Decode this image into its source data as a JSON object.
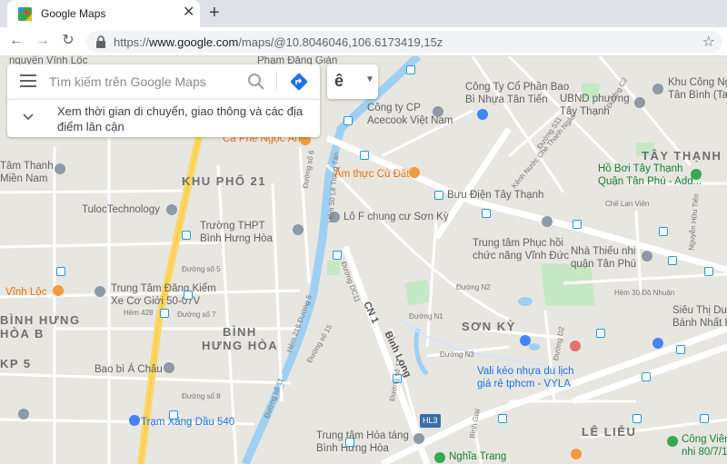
{
  "browser": {
    "tab_title": "Google Maps",
    "tab_close": "✕",
    "new_tab": "+",
    "url_prefix": "https://",
    "url_host": "www.google.com",
    "url_path": "/maps/@10.8046046,106.6173419,15z",
    "back": "←",
    "forward": "→",
    "reload": "↻",
    "star": "☆"
  },
  "search": {
    "placeholder": "Tìm kiếm trên Google Maps",
    "nearby_text": "Xem thời gian di chuyển, giao thông và các địa điểm lân cận",
    "lang_label": "ê",
    "lang_caret": "▼"
  },
  "map": {
    "colors": {
      "road": "#ffffff",
      "highway": "#fdd663",
      "water": "#9fd0f3",
      "park": "#c5e8c5",
      "background": "#e8e6e1",
      "transit_line": "#1a9cd9"
    },
    "areas": {
      "khu_pho_21": "KHU PHỐ 21",
      "tay_thanh": "TÂY THẠNH",
      "binh_hung_hoa_1": "BÌNH",
      "binh_hung_hoa_2": "HƯNG HÒA",
      "son_ky": "SƠN KỲ",
      "le_lieu": "LÊ LIỄU",
      "binh_hung_left_1": "BÌNH HƯNG",
      "binh_hung_left_2": "HÒA B",
      "kp5": "KP 5"
    },
    "pois": {
      "pham_dang": "Phạm Đăng Giản",
      "vinh_loc_top": "nguyện Vĩnh Lộc",
      "cong_ty_cp_bao_bi_1": "Công Ty Cổ Phần Bao",
      "cong_ty_cp_bao_bi_2": "Bì Nhựa Tân Tiến",
      "khu_cong_nghiep_1": "Khu Công Nghiệp",
      "khu_cong_nghiep_2": "Tân Bình (Tanime",
      "acecook_1": "Công ty CP",
      "acecook_2": "Acecook Việt Nam",
      "ubnd_1": "UBND phường",
      "ubnd_2": "Tây Thạnh",
      "ca_phe": "Cà Phê Ngọc Ấn",
      "tam_thanh_1": "Tâm Thanh",
      "tam_thanh_2": "Miền Nam",
      "am_thuc": "Ẩm thực Cù Đất",
      "buu_dien": "Bưu Điện Tây Thạnh",
      "ho_boi_1": "Hồ Bơi Tây Thạnh",
      "ho_boi_2": "Quận Tân Phú - Add...",
      "tuloc": "TulocTechnology",
      "truong_thpt_1": "Trường THPT",
      "truong_thpt_2": "Bình Hưng Hòa",
      "lo_f": "Lô F chung cư Sơn Kỳ",
      "trung_tam_phuc_hoi_1": "Trung tâm Phục hồi",
      "trung_tam_phuc_hoi_2": "chức năng Vĩnh Đức",
      "nha_thieu_nhi_1": "Nhà Thiếu nhi",
      "nha_thieu_nhi_2": "quận Tân Phú",
      "vinh_loc": "Vĩnh Lộc",
      "trung_tam_dang_kiem_1": "Trung Tâm Đăng Kiểm",
      "trung_tam_dang_kiem_2": "Xe Cơ Giới 50-07V",
      "sieu_thi_1": "Siêu Thị Dung",
      "sieu_thi_2": "Bánh Nhất Hư",
      "bao_bi_a_chau": "Bao bì Á Châu",
      "vali_1": "Vali kéo nhựa du lịch",
      "vali_2": "giá rẻ tphcm - VYLA",
      "tram_xang": "Trạm Xăng Dầu 540",
      "hoa_tang_1": "Trung tâm Hỏa táng",
      "hoa_tang_2": "Bình Hưng Hòa",
      "nghia_trang": "Nghĩa Trang",
      "cong_vien_1": "Công Viên",
      "cong_vien_2": "nhi 80/7/1"
    },
    "streets": {
      "cn1": "CN 1",
      "binh_long": "Bình Long",
      "hl3": "HL3",
      "duong_so_6": "Đường số 6",
      "duong_so_5": "Đường số 5",
      "duong_so_7": "Đường số 7",
      "duong_so_15": "Đường số 15",
      "duong_so_11": "Đường số 11",
      "duong_so_13": "Đường số 13",
      "duong_dc11": "Đường DC11",
      "duong_n1": "Đường N1",
      "duong_n2": "Đường N2",
      "duong_n3": "Đường N3",
      "duong_d2": "Đường D2",
      "hem_30": "Hẻm 30 Đô Nhuận",
      "hem_428": "Hẻm 428",
      "kenh": "Kênh Nước Chè Thanh Ngân",
      "che_lan_vien": "Chế Lan Viên",
      "nguyen_huu_tien": "Nguyễn Hữu Tiến",
      "duong_s11": "Đường S11",
      "hem_216": "Hẻm 216 Đường 5",
      "hem_le_trong_tan": "Hẻm 50 Lê Trọng Tấn",
      "duong_so_8": "Đường số 8",
      "binh_giai": "Bình Giai",
      "duong_c2": "Đường C2"
    }
  }
}
